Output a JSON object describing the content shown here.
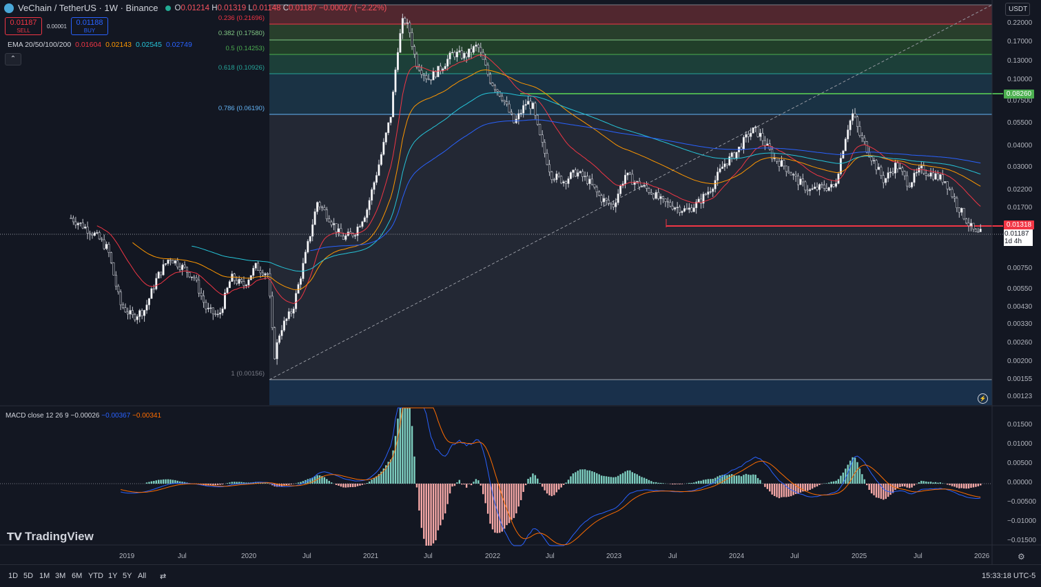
{
  "header": {
    "symbol": "VeChain / TetherUS · 1W · Binance",
    "open_label": "O",
    "open": "0.01214",
    "high_label": "H",
    "high": "0.01319",
    "low_label": "L",
    "low": "0.01148",
    "close_label": "C",
    "close": "0.01187",
    "change": "−0.00027 (−2.22%)"
  },
  "trade": {
    "sell_price": "0.01187",
    "sell_label": "SELL",
    "spread": "0.00001",
    "buy_price": "0.01188",
    "buy_label": "BUY"
  },
  "ema": {
    "label": "EMA 20/50/100/200",
    "values": [
      "0.01604",
      "0.02143",
      "0.02545",
      "0.02749"
    ],
    "colors": [
      "#f23645",
      "#ff9800",
      "#26c6da",
      "#2962ff"
    ]
  },
  "fib": [
    {
      "label": "0.236 (0.21696)",
      "color": "#f23645"
    },
    {
      "label": "0.382 (0.17580)",
      "color": "#81c784"
    },
    {
      "label": "0.5 (0.14253)",
      "color": "#4caf50"
    },
    {
      "label": "0.618 (0.10926)",
      "color": "#26a69a"
    },
    {
      "label": "0.786 (0.06190)",
      "color": "#64b5f6"
    },
    {
      "label": "1 (0.00156)",
      "color": "#787b86"
    }
  ],
  "yaxis": {
    "currency": "USDT",
    "labels": [
      "0.22000",
      "0.17000",
      "0.13000",
      "0.10000",
      "0.07500",
      "0.05500",
      "0.04000",
      "0.03000",
      "0.02200",
      "0.01700",
      "0.00750",
      "0.00550",
      "0.00430",
      "0.00330",
      "0.00260",
      "0.00200",
      "0.00155",
      "0.00123"
    ],
    "tag_green": "0.08260",
    "tag_red": "0.01318",
    "tag_current": "0.01187",
    "tag_countdown": "1d 4h"
  },
  "macd": {
    "label": "MACD close 12 26 9",
    "v1": "−0.00026",
    "v2": "−0.00367",
    "v3": "−0.00341",
    "axis": [
      "0.01500",
      "0.01000",
      "0.00500",
      "0.00000",
      "−0.00500",
      "−0.01000",
      "−0.01500"
    ]
  },
  "xaxis": [
    "2019",
    "Jul",
    "2020",
    "Jul",
    "2021",
    "Jul",
    "2022",
    "Jul",
    "2023",
    "Jul",
    "2024",
    "Jul",
    "2025",
    "Jul",
    "2026"
  ],
  "branding": {
    "logo": "TradingView"
  },
  "bottom": {
    "ranges": [
      "1D",
      "5D",
      "1M",
      "3M",
      "6M",
      "YTD",
      "1Y",
      "5Y",
      "All"
    ],
    "clock": "15:33:18 UTC-5"
  },
  "chart_data": {
    "type": "candlestick",
    "title": "VeChain / TetherUS · 1W · Binance",
    "scale": "log",
    "ylim": [
      0.00115,
      0.26
    ],
    "series_close": [
      [
        2018.6,
        0.0145
      ],
      [
        2018.7,
        0.013
      ],
      [
        2018.8,
        0.0115
      ],
      [
        2018.9,
        0.0095
      ],
      [
        2019.0,
        0.0045
      ],
      [
        2019.1,
        0.0038
      ],
      [
        2019.2,
        0.0042
      ],
      [
        2019.3,
        0.0065
      ],
      [
        2019.4,
        0.0085
      ],
      [
        2019.5,
        0.0075
      ],
      [
        2019.6,
        0.0065
      ],
      [
        2019.7,
        0.0042
      ],
      [
        2019.8,
        0.0038
      ],
      [
        2019.9,
        0.0065
      ],
      [
        2020.0,
        0.0058
      ],
      [
        2020.1,
        0.0075
      ],
      [
        2020.2,
        0.0068
      ],
      [
        2020.25,
        0.0022
      ],
      [
        2020.3,
        0.0032
      ],
      [
        2020.4,
        0.0042
      ],
      [
        2020.5,
        0.0085
      ],
      [
        2020.6,
        0.018
      ],
      [
        2020.7,
        0.0145
      ],
      [
        2020.8,
        0.011
      ],
      [
        2020.9,
        0.0118
      ],
      [
        2021.0,
        0.016
      ],
      [
        2021.1,
        0.03
      ],
      [
        2021.2,
        0.06
      ],
      [
        2021.25,
        0.14
      ],
      [
        2021.3,
        0.22
      ],
      [
        2021.35,
        0.18
      ],
      [
        2021.4,
        0.12
      ],
      [
        2021.5,
        0.095
      ],
      [
        2021.6,
        0.11
      ],
      [
        2021.7,
        0.135
      ],
      [
        2021.8,
        0.13
      ],
      [
        2021.9,
        0.15
      ],
      [
        2022.0,
        0.095
      ],
      [
        2022.1,
        0.075
      ],
      [
        2022.2,
        0.052
      ],
      [
        2022.3,
        0.07
      ],
      [
        2022.35,
        0.065
      ],
      [
        2022.4,
        0.045
      ],
      [
        2022.5,
        0.026
      ],
      [
        2022.6,
        0.024
      ],
      [
        2022.7,
        0.027
      ],
      [
        2022.8,
        0.024
      ],
      [
        2022.9,
        0.019
      ],
      [
        2023.0,
        0.017
      ],
      [
        2023.1,
        0.026
      ],
      [
        2023.2,
        0.023
      ],
      [
        2023.3,
        0.021
      ],
      [
        2023.4,
        0.018
      ],
      [
        2023.5,
        0.017
      ],
      [
        2023.6,
        0.016
      ],
      [
        2023.7,
        0.018
      ],
      [
        2023.8,
        0.022
      ],
      [
        2023.9,
        0.03
      ],
      [
        2024.0,
        0.035
      ],
      [
        2024.1,
        0.045
      ],
      [
        2024.15,
        0.048
      ],
      [
        2024.2,
        0.044
      ],
      [
        2024.3,
        0.033
      ],
      [
        2024.4,
        0.029
      ],
      [
        2024.5,
        0.024
      ],
      [
        2024.6,
        0.021
      ],
      [
        2024.7,
        0.022
      ],
      [
        2024.8,
        0.022
      ],
      [
        2024.9,
        0.048
      ],
      [
        2024.95,
        0.06
      ],
      [
        2025.0,
        0.045
      ],
      [
        2025.1,
        0.033
      ],
      [
        2025.2,
        0.024
      ],
      [
        2025.3,
        0.03
      ],
      [
        2025.4,
        0.023
      ],
      [
        2025.5,
        0.028
      ],
      [
        2025.6,
        0.026
      ],
      [
        2025.7,
        0.024
      ],
      [
        2025.8,
        0.017
      ],
      [
        2025.9,
        0.013
      ],
      [
        2025.95,
        0.0115
      ],
      [
        2025.99,
        0.01187
      ]
    ]
  }
}
